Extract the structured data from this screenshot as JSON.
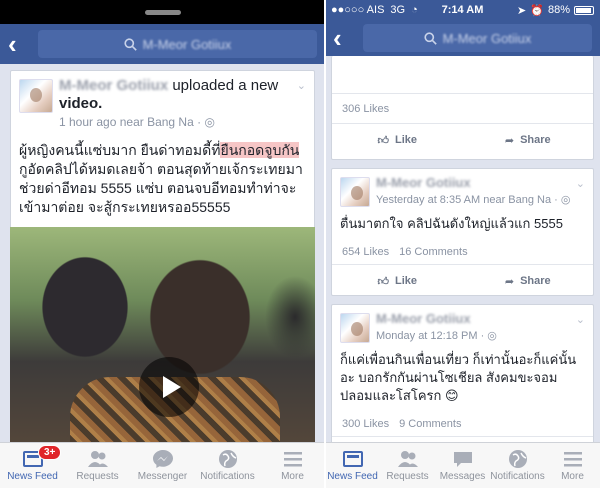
{
  "left": {
    "search_name": "M-Meor Gotiiux",
    "post": {
      "author": "M-Meor Gotiiux",
      "action": "uploaded a new",
      "object": "video.",
      "time": "1 hour ago near Bang Na",
      "text_before": "ผู้หญิงคนนี้แซ่บมาก ยืนด่าทอมดี้ที่",
      "text_highlight": "ยืนกอดจูบกัน",
      "text_after": " กูอัดคลิปได้หมดเลยจ้า ตอนสุดท้ายเจ้กระเทยมาช่วยด่าอีทอม 5555 แซ่บ ตอนจบอีทอมทำท่าจะเข้ามาต่อย จะสู้กระเทยหรออ55555"
    },
    "tabs": [
      {
        "label": "News Feed",
        "icon": "news-feed-icon",
        "badge": "3+"
      },
      {
        "label": "Requests",
        "icon": "requests-icon"
      },
      {
        "label": "Messenger",
        "icon": "messenger-icon"
      },
      {
        "label": "Notifications",
        "icon": "globe-icon"
      },
      {
        "label": "More",
        "icon": "menu-icon"
      }
    ]
  },
  "right": {
    "status": {
      "carrier": "●●○○○ AIS",
      "network": "3G",
      "time": "7:14 AM",
      "battery": "88%"
    },
    "search_name": "M-Meor Gotiiux",
    "top_card": {
      "likes": "306 Likes",
      "like_label": "Like",
      "share_label": "Share"
    },
    "post1": {
      "author": "M-Meor Gotiiux",
      "time": "Yesterday at 8:35 AM near Bang Na",
      "text": "ตื่นมาตกใจ คลิปฉันดังใหญ่แล้วแก 5555",
      "likes": "654 Likes",
      "comments": "16 Comments",
      "like_label": "Like",
      "share_label": "Share"
    },
    "post2": {
      "author": "M-Meor Gotiiux",
      "time": "Monday at 12:18 PM",
      "text": "ก็แค่เพื่อนกินเพื่อนเที่ยว ก็เท่านั้นอะก็แค่นั้นอะ บอกรักกันผ่านโซเชียล สังคมขะจอมปลอมและโสโครก 😊",
      "likes": "300 Likes",
      "comments": "9 Comments"
    },
    "tabs": [
      {
        "label": "News Feed",
        "icon": "news-feed-icon"
      },
      {
        "label": "Requests",
        "icon": "requests-icon"
      },
      {
        "label": "Messages",
        "icon": "messages-icon"
      },
      {
        "label": "Notifications",
        "icon": "globe-icon"
      },
      {
        "label": "More",
        "icon": "menu-icon"
      }
    ]
  },
  "colors": {
    "brand": "#3b5998",
    "active_tab": "#4267b2",
    "badge": "#e0252a",
    "highlight": "#f6c6c6"
  }
}
